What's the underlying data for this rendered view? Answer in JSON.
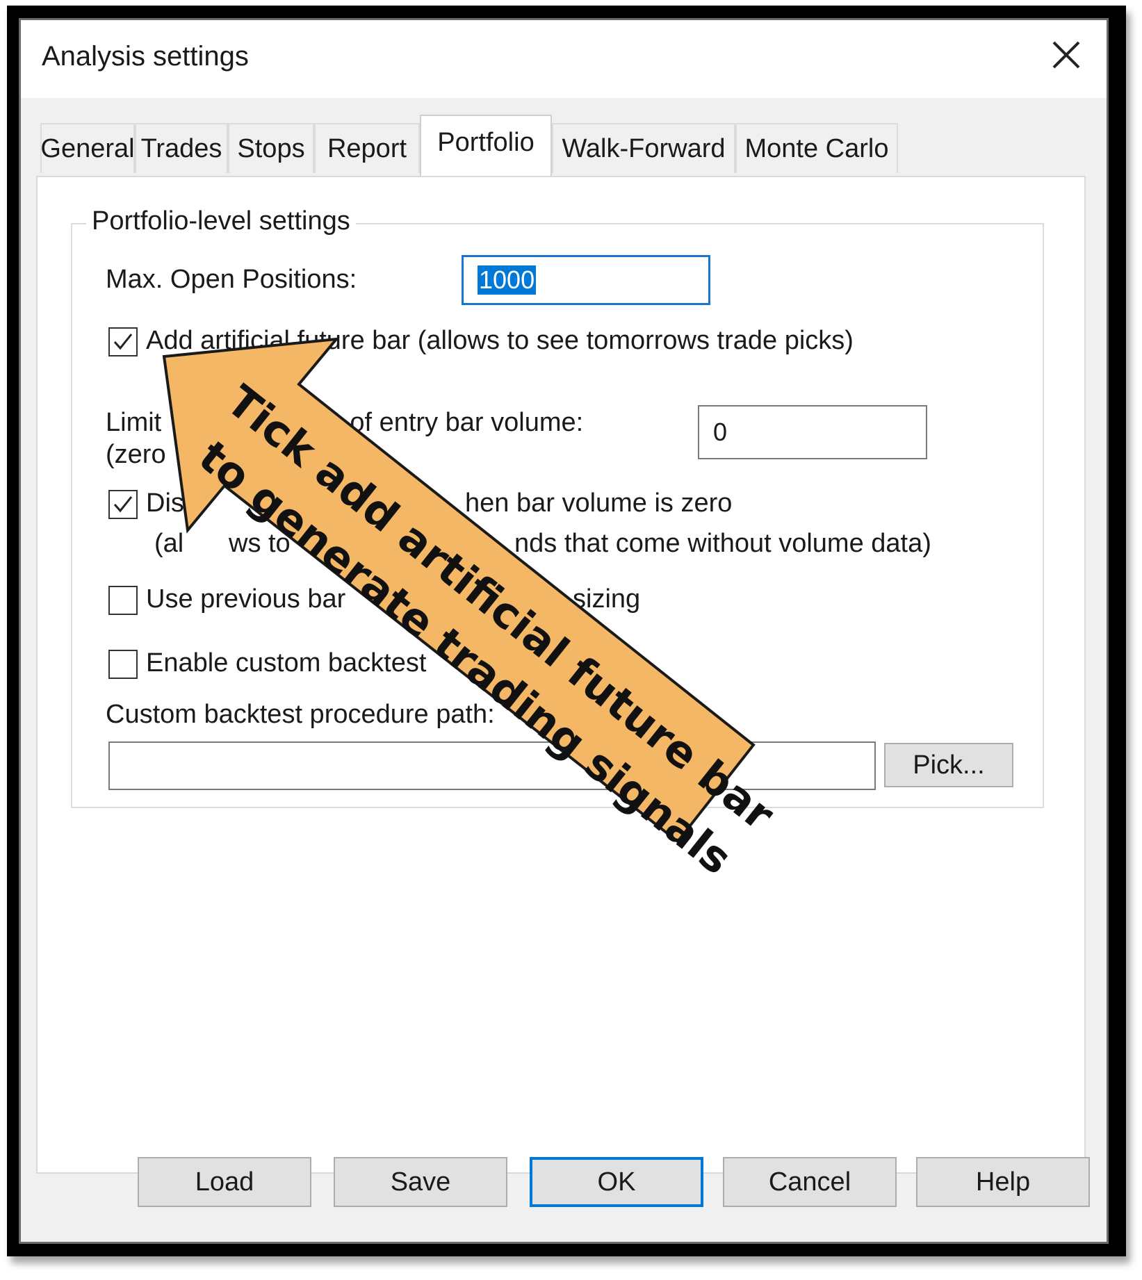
{
  "window": {
    "title": "Analysis settings",
    "close_icon": "close-icon"
  },
  "tabs": [
    {
      "label": "General",
      "active": false
    },
    {
      "label": "Trades",
      "active": false
    },
    {
      "label": "Stops",
      "active": false
    },
    {
      "label": "Report",
      "active": false
    },
    {
      "label": "Portfolio",
      "active": true
    },
    {
      "label": "Walk-Forward",
      "active": false
    },
    {
      "label": "Monte Carlo",
      "active": false
    }
  ],
  "portfolio": {
    "group_title": "Portfolio-level settings",
    "max_open_positions_label": "Max. Open Positions:",
    "max_open_positions_value": "1000",
    "add_future_bar": {
      "label": "Add artificial future bar (allows to see tomorrows trade picks)",
      "checked": true
    },
    "limit_label_line1_a": "Limit",
    "limit_label_line1_b": "% of entry bar volume:",
    "limit_label_line2": "(zero",
    "limit_value": "0",
    "disable_volume": {
      "label_start": "Dis",
      "label_end": "hen bar volume is zero",
      "sub_start": "(al",
      "sub_mid": "ws to",
      "sub_end": "nds that come without volume data)",
      "checked": true
    },
    "use_previous_bar": {
      "label_start": "Use previous bar",
      "label_end": "sizing",
      "checked": false
    },
    "enable_custom_backtest": {
      "label": "Enable custom backtest",
      "checked": false
    },
    "custom_path_label": "Custom backtest procedure path:",
    "custom_path_value": "",
    "pick_button": "Pick..."
  },
  "buttons": {
    "load": "Load",
    "save": "Save",
    "ok": "OK",
    "cancel": "Cancel",
    "help": "Help"
  },
  "annotation": {
    "line1": "Tick add artificial future bar",
    "line2": "to generate trading signals",
    "fill_color": "#f4b765",
    "stroke_color": "#1a1a1a"
  }
}
